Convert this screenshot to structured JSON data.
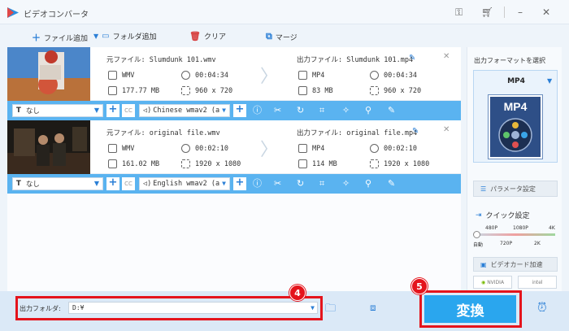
{
  "window": {
    "title": "ビデオコンバータ"
  },
  "toolbar": {
    "add_file": "ファイル追加",
    "add_folder": "フォルダ追加",
    "clear": "クリア",
    "merge": "マージ"
  },
  "files": [
    {
      "source_name": "元ファイル: Slumdunk 101.wmv",
      "output_name": "出力ファイル: Slumdunk 101.mp4",
      "src": {
        "format": "WMV",
        "duration": "00:04:34",
        "size": "177.77 MB",
        "resolution": "960 x 720"
      },
      "out": {
        "format": "MP4",
        "duration": "00:04:34",
        "size": "83 MB",
        "resolution": "960 x 720"
      },
      "subtitle": "なし",
      "audio": "Chinese wmav2 (a"
    },
    {
      "source_name": "元ファイル: original file.wmv",
      "output_name": "出力ファイル: original file.mp4",
      "src": {
        "format": "WMV",
        "duration": "00:02:10",
        "size": "161.02 MB",
        "resolution": "1920 x 1080"
      },
      "out": {
        "format": "MP4",
        "duration": "00:02:10",
        "size": "114 MB",
        "resolution": "1920 x 1080"
      },
      "subtitle": "なし",
      "audio": "English wmav2 (a"
    }
  ],
  "panel": {
    "title": "出力フォーマットを選択",
    "format": "MP4",
    "format_art_label": "MP4",
    "param_settings": "パラメータ設定",
    "quick_settings": "クイック設定",
    "slider_top": [
      "480P",
      "1080P",
      "4K"
    ],
    "slider_bottom": [
      "自動",
      "720P",
      "2K"
    ],
    "gpu_accel": "ビデオカード加速",
    "vendors": [
      "NVIDIA",
      "intel"
    ]
  },
  "bottom": {
    "output_folder_label": "出力フォルダ:",
    "output_folder_value": "D:¥",
    "convert": "変換",
    "badge_output": "4",
    "badge_convert": "5"
  },
  "colors": {
    "accent": "#2aa6ee",
    "bar": "#5ab3f0",
    "highlight": "#e4141c"
  }
}
